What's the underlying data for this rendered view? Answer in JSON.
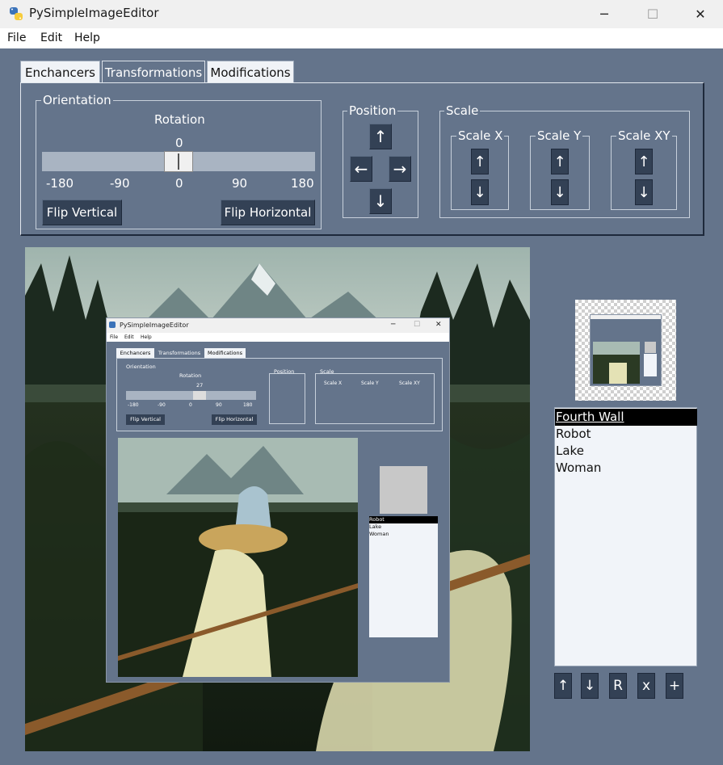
{
  "window": {
    "title": "PySimpleImageEditor",
    "minimize": "─",
    "maximize": "☐",
    "close": "✕"
  },
  "menu": {
    "file": "File",
    "edit": "Edit",
    "help": "Help"
  },
  "tabs": [
    "Enchancers",
    "Transformations",
    "Modifications"
  ],
  "orientation": {
    "frame_title": "Orientation",
    "rotation_label": "Rotation",
    "rotation_value": "0",
    "rotation_fraction": 0.5,
    "ticks": [
      "-180",
      "-90",
      "0",
      "90",
      "180"
    ],
    "flip_vertical": "Flip Vertical",
    "flip_horizontal": "Flip Horizontal"
  },
  "position": {
    "frame_title": "Position",
    "up": "↑",
    "left": "←",
    "right": "→",
    "down": "↓"
  },
  "scale": {
    "frame_title": "Scale",
    "x": {
      "title": "Scale X",
      "up": "↑",
      "down": "↓"
    },
    "y": {
      "title": "Scale Y",
      "up": "↑",
      "down": "↓"
    },
    "xy": {
      "title": "Scale XY",
      "up": "↑",
      "down": "↓"
    }
  },
  "layers": [
    "Fourth Wall",
    "Robot",
    "Lake",
    "Woman"
  ],
  "layer_buttons": {
    "up": "↑",
    "down": "↓",
    "reset": "R",
    "delete": "x",
    "add": "+"
  },
  "nested": {
    "title": "PySimpleImageEditor",
    "menu": [
      "File",
      "Edit",
      "Help"
    ],
    "tabs": [
      "Enchancers",
      "Transformations",
      "Modifications"
    ],
    "orientation": "Orientation",
    "rotation": "Rotation",
    "rotation_value": "27",
    "ticks": [
      "-180",
      "-90",
      "0",
      "90",
      "180"
    ],
    "flip_vertical": "Flip Vertical",
    "flip_horizontal": "Flip Horizontal",
    "position": "Position",
    "scale": "Scale",
    "scale_x": "Scale X",
    "scale_y": "Scale Y",
    "scale_xy": "Scale XY",
    "layers": [
      "Robot",
      "Lake",
      "Woman"
    ]
  },
  "colors": {
    "background": "#64748b",
    "button": "#334155",
    "selected": "#000000"
  }
}
